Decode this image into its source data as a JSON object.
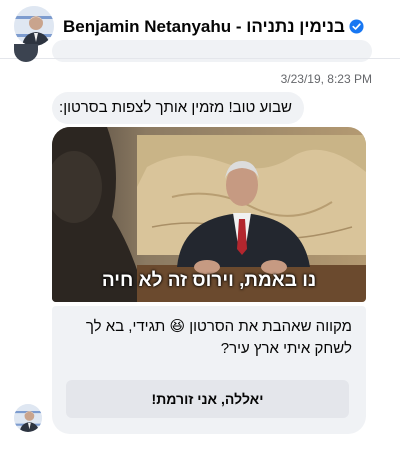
{
  "header": {
    "title": "Benjamin Netanyahu - בנימין נתניהו",
    "verified_color": "#1877f2"
  },
  "conversation": {
    "timestamp": "3/23/19, 8:23 PM",
    "message_1": "שבוע טוב! מזמין אותך לצפות בסרטון:",
    "video_caption": "נו באמת, וירוס זה לא חיה",
    "card": {
      "text": "מקווה שאהבת את הסרטון 😆 תגידי, בא לך לשחק איתי ארץ עיר?",
      "button_label": "יאללה, אני זורמת!"
    }
  },
  "colors": {
    "bubble": "#f0f2f5",
    "button": "#e4e6eb",
    "secondary_text": "#65676b"
  }
}
